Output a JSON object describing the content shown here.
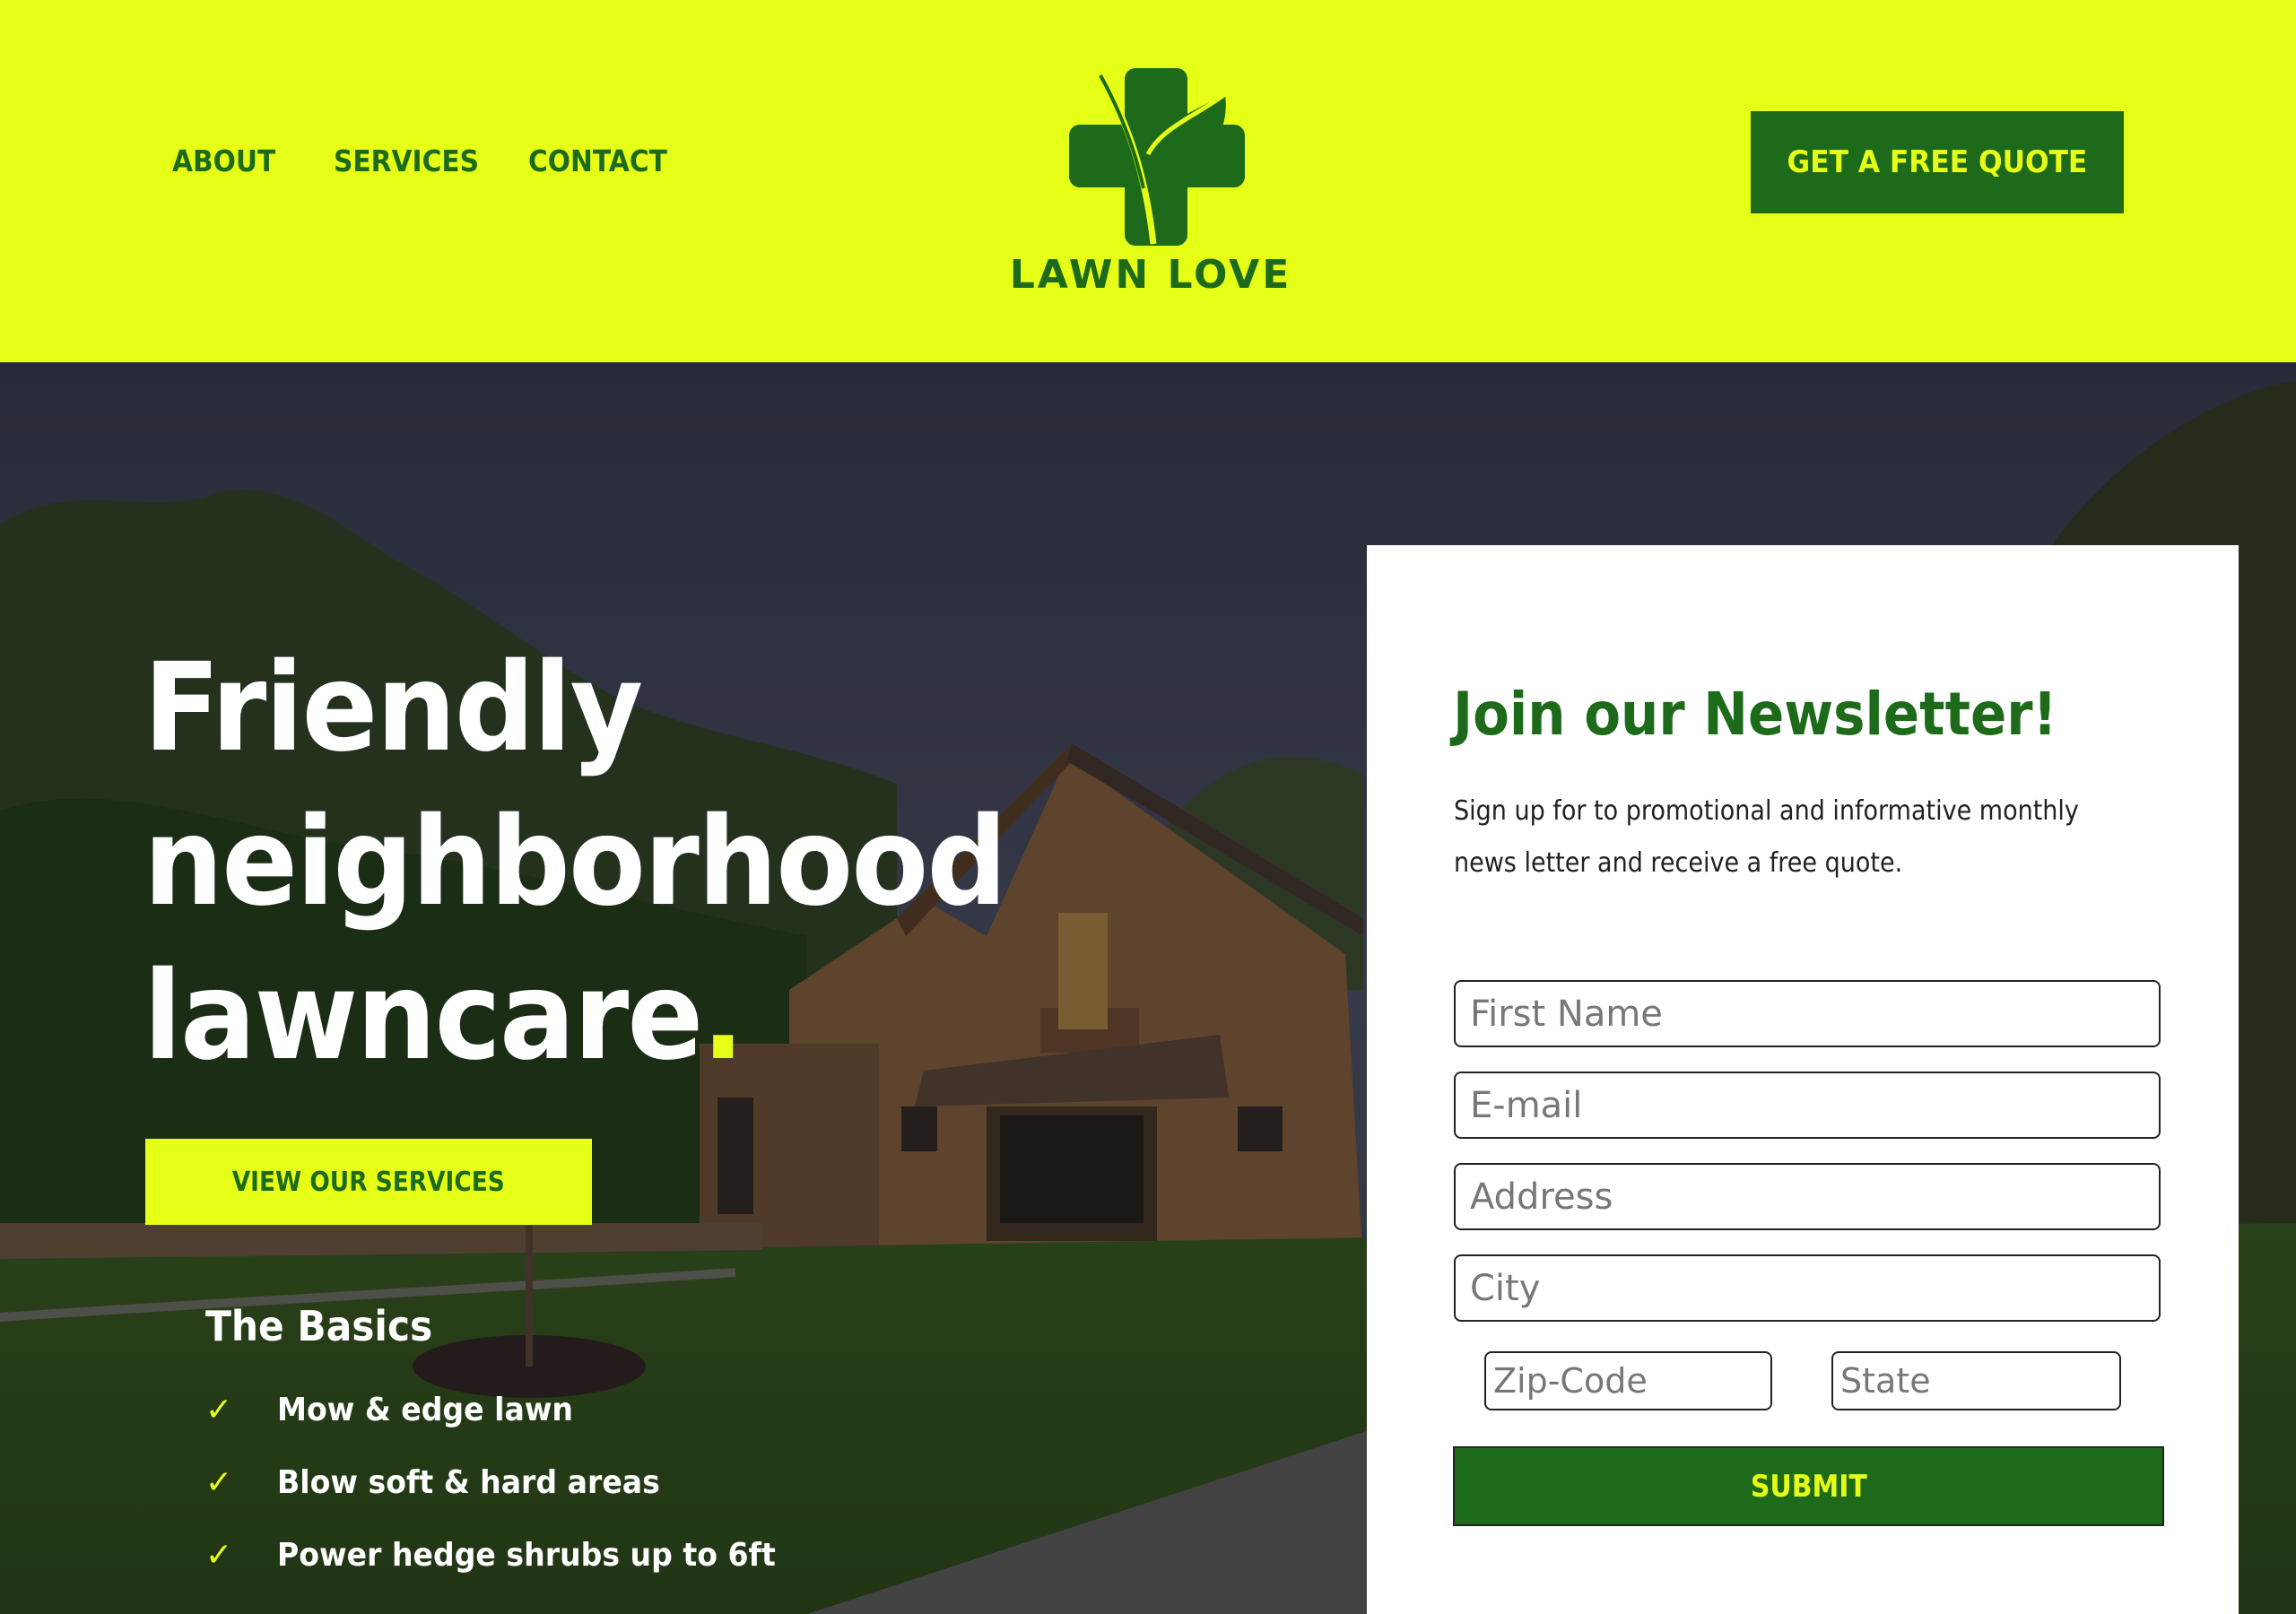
{
  "colors": {
    "brand_yellow": "#e6ff16",
    "brand_green": "#1d6b1a",
    "card_bg": "#ffffff",
    "text_dark": "#222222"
  },
  "header": {
    "nav": [
      {
        "label": "ABOUT"
      },
      {
        "label": "SERVICES"
      },
      {
        "label": "CONTACT"
      }
    ],
    "logo": {
      "icon": "cross-leaf-icon",
      "text": "LAWN LOVE"
    },
    "cta_label": "GET A FREE QUOTE"
  },
  "hero": {
    "title_lines": [
      "Friendly",
      "neighborhood",
      "lawncare"
    ],
    "title_punct": ".",
    "services_button_label": "VIEW OUR SERVICES",
    "basics": {
      "title": "The Basics",
      "check_icon": "✓",
      "items": [
        {
          "label": "Mow & edge lawn"
        },
        {
          "label": "Blow soft & hard areas"
        },
        {
          "label": "Power hedge shrubs up to 6ft"
        }
      ]
    }
  },
  "newsletter": {
    "title": "Join our Newsletter!",
    "description": "Sign up for to promotional and informative monthly news letter and receive a free quote.",
    "fields": {
      "first_name": {
        "placeholder": "First Name",
        "value": ""
      },
      "email": {
        "placeholder": "E-mail",
        "value": ""
      },
      "address": {
        "placeholder": "Address",
        "value": ""
      },
      "city": {
        "placeholder": "City",
        "value": ""
      },
      "zip": {
        "placeholder": "Zip-Code",
        "value": ""
      },
      "state": {
        "placeholder": "State",
        "value": ""
      }
    },
    "submit_label": "SUBMIT"
  }
}
